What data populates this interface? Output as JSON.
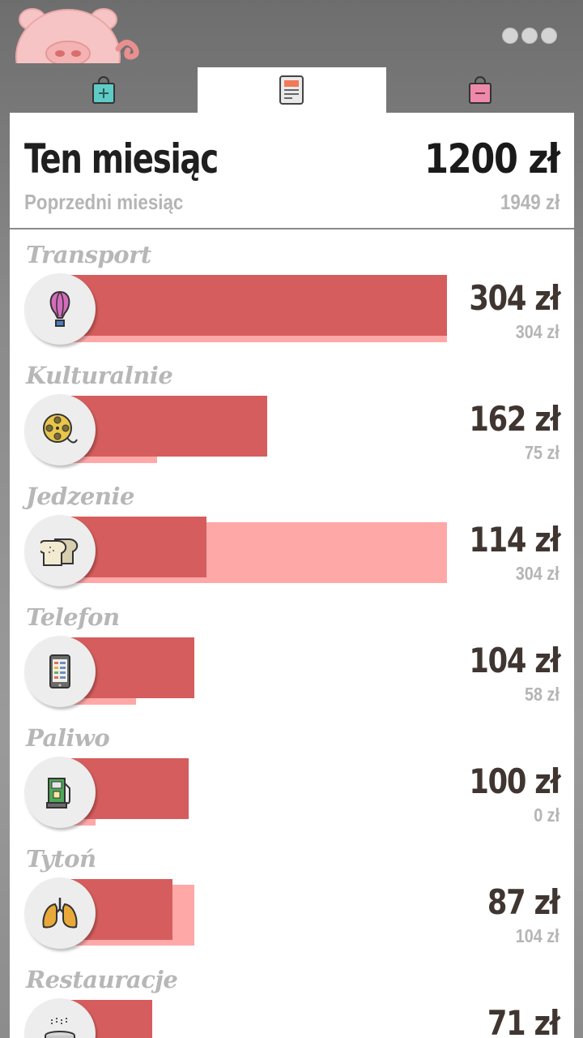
{
  "header": {
    "logo": "pig-logo",
    "menu_icon": "more-dots-icon",
    "tabs": [
      {
        "icon": "add-income-bag-icon",
        "color": "#5fcbc7"
      },
      {
        "icon": "report-document-icon",
        "color": "#4a4a4a",
        "active": true
      },
      {
        "icon": "remove-expense-bag-icon",
        "color": "#ee8aa9"
      }
    ]
  },
  "summary": {
    "current_label": "Ten miesiąc",
    "current_total": "1200 zł",
    "previous_label": "Poprzedni miesiąc",
    "previous_total": "1949 zł"
  },
  "categories": [
    {
      "name": "Transport",
      "current": "304 zł",
      "previous": "304 zł",
      "current_value": 304,
      "previous_value": 304,
      "icon": "hot-air-balloon-icon"
    },
    {
      "name": "Kulturalnie",
      "current": "162 zł",
      "previous": "75 zł",
      "current_value": 162,
      "previous_value": 75,
      "icon": "film-reel-icon"
    },
    {
      "name": "Jedzenie",
      "current": "114 zł",
      "previous": "304 zł",
      "current_value": 114,
      "previous_value": 304,
      "icon": "bread-icon"
    },
    {
      "name": "Telefon",
      "current": "104 zł",
      "previous": "58 zł",
      "current_value": 104,
      "previous_value": 58,
      "icon": "smartphone-icon"
    },
    {
      "name": "Paliwo",
      "current": "100 zł",
      "previous": "0 zł",
      "current_value": 100,
      "previous_value": 0,
      "icon": "fuel-pump-icon"
    },
    {
      "name": "Tytoń",
      "current": "87 zł",
      "previous": "104 zł",
      "current_value": 87,
      "previous_value": 104,
      "icon": "lungs-icon"
    },
    {
      "name": "Restauracje",
      "current": "71 zł",
      "previous": "",
      "current_value": 71,
      "previous_value": null,
      "icon": "hot-dish-icon"
    }
  ],
  "colors": {
    "bar_current": "#d65d5d",
    "bar_previous": "#ffa8a8",
    "pig": "#f6c4c4"
  }
}
